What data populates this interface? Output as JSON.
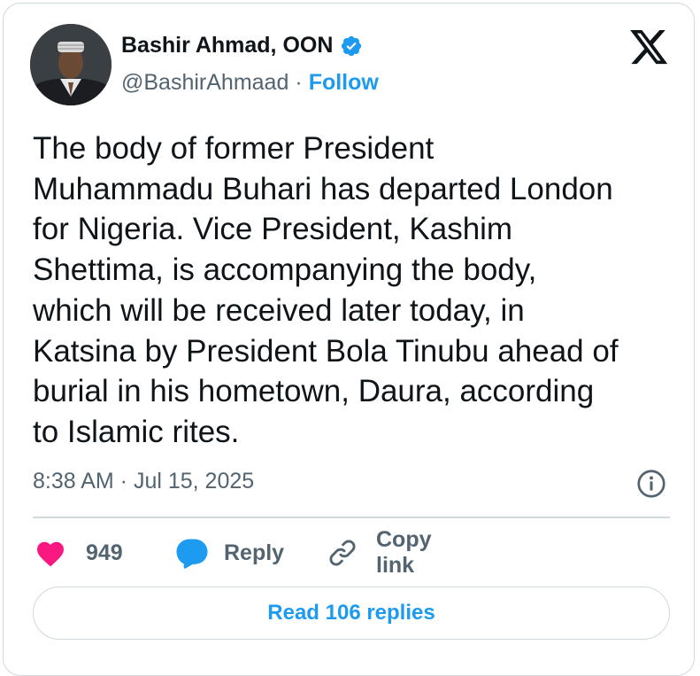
{
  "author": {
    "name": "Bashir Ahmad, OON",
    "handle": "@BashirAhmaad",
    "separator": "·",
    "follow_label": "Follow"
  },
  "tweet": {
    "text": "The body of former President\nMuhammadu Buhari has departed London\nfor Nigeria. Vice President, Kashim\nShettima, is accompanying the body,\nwhich will be received later today, in\nKatsina by President Bola Tinubu ahead of\nburial in his hometown, Daura, according\nto Islamic rites.",
    "timestamp": "8:38 AM · Jul 15, 2025"
  },
  "actions": {
    "like_count": "949",
    "reply_label": "Reply",
    "copy_link_label": "Copy link"
  },
  "read_replies_label": "Read 106 replies",
  "icons": {
    "brand": "x-logo-icon",
    "verified": "verified-badge-icon",
    "info": "info-icon",
    "like": "heart-icon",
    "reply": "speech-bubble-icon",
    "copy": "link-icon"
  },
  "colors": {
    "accent": "#1d9bf0",
    "like": "#f91880",
    "text": "#0f1419",
    "secondary": "#536471",
    "border": "#cfd9de"
  }
}
